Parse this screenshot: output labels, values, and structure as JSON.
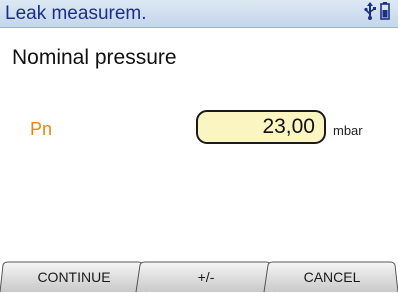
{
  "header": {
    "title": "Leak measurem.",
    "icons": [
      "usb-icon",
      "battery-icon"
    ]
  },
  "main": {
    "subtitle": "Nominal pressure",
    "parameter": {
      "label": "Pn",
      "value": "23,00",
      "unit": "mbar"
    }
  },
  "softkeys": {
    "left": "CONTINUE",
    "middle": "+/-",
    "right": "CANCEL"
  },
  "colors": {
    "title_text": "#1c2f86",
    "title_bar": "#c3d6ea",
    "param_label": "#e8860a",
    "value_box": "#fbf5c2"
  }
}
